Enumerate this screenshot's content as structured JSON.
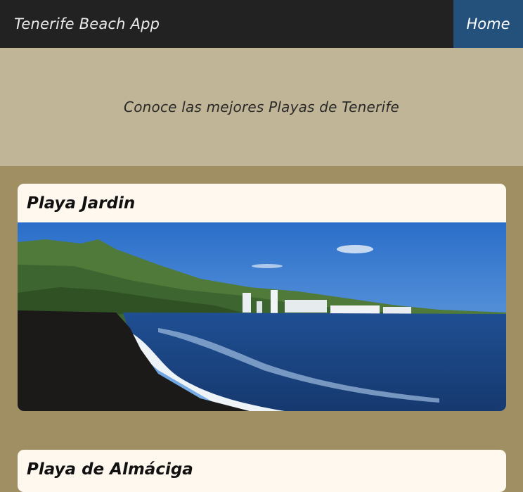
{
  "navbar": {
    "brand": "Tenerife Beach App",
    "home_label": "Home"
  },
  "hero": {
    "text": "Conoce las mejores Playas de Tenerife"
  },
  "beaches": [
    {
      "name": "Playa Jardin"
    },
    {
      "name": "Playa de Almáciga"
    }
  ],
  "colors": {
    "navbar": "#222222",
    "home_active": "#24507c",
    "hero_bg": "#c1b597",
    "page_bg": "#a08f63",
    "card_bg": "#fff8ef"
  }
}
